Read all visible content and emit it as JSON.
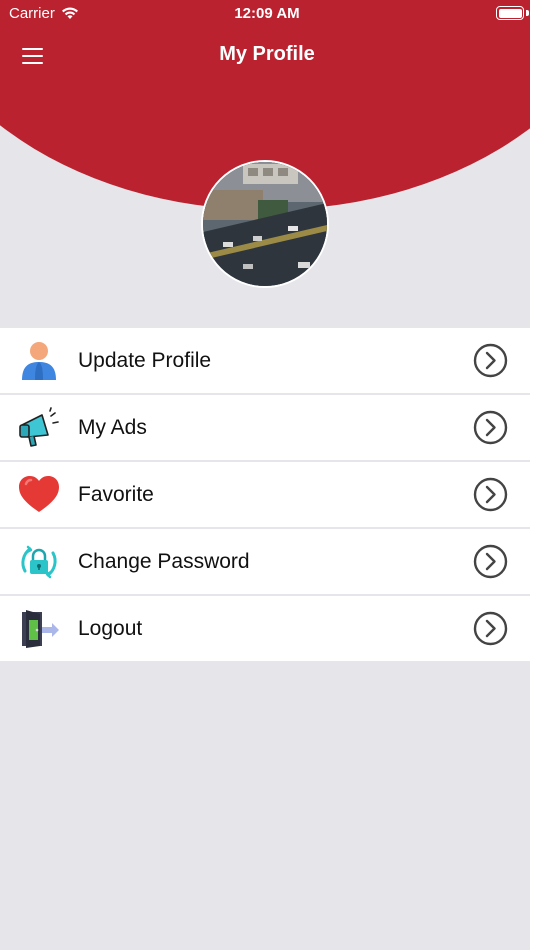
{
  "status_bar": {
    "carrier": "Carrier",
    "time": "12:09 AM"
  },
  "nav": {
    "title": "My Profile",
    "menu_icon": "hamburger-icon"
  },
  "avatar": {
    "alt": "street-view-photo"
  },
  "menu": [
    {
      "label": "Update Profile",
      "icon": "user-icon"
    },
    {
      "label": "My Ads",
      "icon": "megaphone-icon"
    },
    {
      "label": "Favorite",
      "icon": "heart-icon"
    },
    {
      "label": "Change Password",
      "icon": "lock-icon"
    },
    {
      "label": "Logout",
      "icon": "logout-door-icon"
    }
  ],
  "colors": {
    "brand_red": "#ba222f",
    "background": "#e5e5ea",
    "chevron": "#444444"
  }
}
